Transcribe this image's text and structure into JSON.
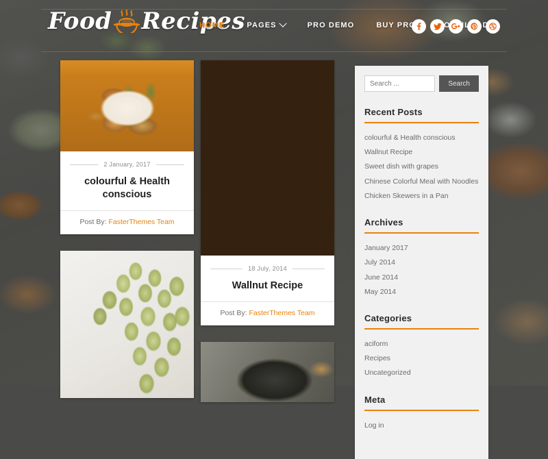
{
  "site": {
    "logo_word1": "Food",
    "logo_word2": "Recipes",
    "logo_icon": "bowl-icon"
  },
  "nav": {
    "items": [
      {
        "label": "HOME",
        "active": true,
        "has_dropdown": false
      },
      {
        "label": "PAGES",
        "active": false,
        "has_dropdown": true
      },
      {
        "label": "PRO DEMO",
        "active": false,
        "has_dropdown": false
      },
      {
        "label": "BUY PRO",
        "active": false,
        "has_dropdown": false
      },
      {
        "label": "DOWNLOAD",
        "active": false,
        "has_dropdown": false
      }
    ]
  },
  "social": {
    "items": [
      {
        "name": "facebook-icon",
        "glyph": "f"
      },
      {
        "name": "twitter-icon",
        "glyph": "t"
      },
      {
        "name": "google-plus-icon",
        "glyph": "g+"
      },
      {
        "name": "pinterest-icon",
        "glyph": "p"
      },
      {
        "name": "dribbble-icon",
        "glyph": "d"
      }
    ]
  },
  "posts": [
    {
      "image": "chicken-wings-photo",
      "date": "2 January, 2017",
      "title": "colourful & Health conscious",
      "post_by_label": "Post By:",
      "author": "FasterThemes Team"
    },
    {
      "image": "walnuts-photo",
      "date": "18 July, 2014",
      "title": "Wallnut Recipe",
      "post_by_label": "Post By:",
      "author": "FasterThemes Team"
    },
    {
      "image": "grapes-photo"
    },
    {
      "image": "noodles-photo"
    }
  ],
  "sidebar": {
    "search": {
      "placeholder": "Search ...",
      "value": "",
      "button_label": "Search"
    },
    "widgets": [
      {
        "title": "Recent Posts",
        "items": [
          "colourful & Health conscious",
          "Wallnut Recipe",
          "Sweet dish with grapes",
          "Chinese Colorful Meal with Noodles",
          "Chicken Skewers in a Pan"
        ]
      },
      {
        "title": "Archives",
        "items": [
          "January 2017",
          "July 2014",
          "June 2014",
          "May 2014"
        ]
      },
      {
        "title": "Categories",
        "items": [
          "aciform",
          "Recipes",
          "Uncategorized"
        ]
      },
      {
        "title": "Meta",
        "items": [
          "Log in"
        ]
      }
    ]
  },
  "colors": {
    "accent": "#e8820c",
    "header_text": "#ffffff",
    "sidebar_bg": "#f1f1f1",
    "search_button_bg": "#555555"
  }
}
